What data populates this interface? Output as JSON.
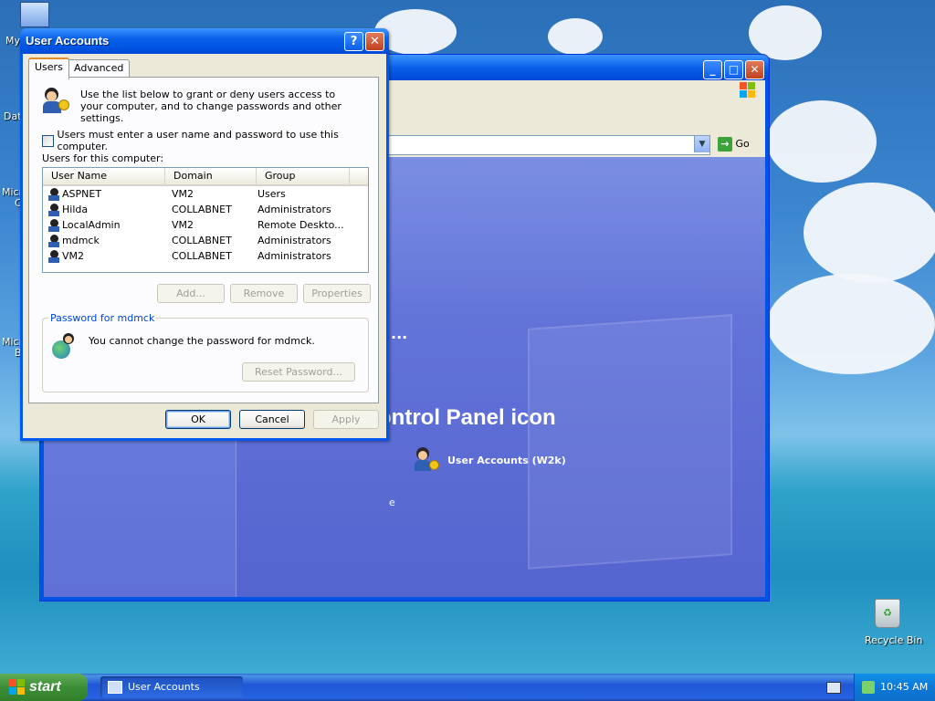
{
  "desktop": {
    "icons": [
      {
        "label": "My",
        "name": "my-computer"
      },
      {
        "label": "Dat",
        "name": "data"
      },
      {
        "label": "Micro",
        "name": "micro-1"
      },
      {
        "label": "Micro",
        "name": "micro-2"
      },
      {
        "label": "Recycle Bin",
        "name": "recycle-bin"
      }
    ],
    "icon_c": "C",
    "icon_b": "B"
  },
  "control_panel": {
    "go_label": "Go",
    "heading_fragment": "ontrol Panel icon",
    "ellipsis": "...",
    "item_label": "User Accounts (W2k)",
    "left_fragment": "e"
  },
  "dialog": {
    "title": "User Accounts",
    "tabs": [
      {
        "label": "Users",
        "active": true
      },
      {
        "label": "Advanced",
        "active": false
      }
    ],
    "intro_text": "Use the list below to grant or deny users access to your computer, and to change passwords and other settings.",
    "checkbox_label": "Users must enter a user name and password to use this computer.",
    "checkbox_checked": false,
    "list_label": "Users for this computer:",
    "columns": [
      "User Name",
      "Domain",
      "Group"
    ],
    "rows": [
      {
        "user": "ASPNET",
        "domain": "VM2",
        "group": "Users"
      },
      {
        "user": "Hilda",
        "domain": "COLLABNET",
        "group": "Administrators"
      },
      {
        "user": "LocalAdmin",
        "domain": "VM2",
        "group": "Remote Deskto..."
      },
      {
        "user": "mdmck",
        "domain": "COLLABNET",
        "group": "Administrators"
      },
      {
        "user": "VM2",
        "domain": "COLLABNET",
        "group": "Administrators"
      }
    ],
    "buttons": {
      "add": "Add...",
      "remove": "Remove",
      "properties": "Properties"
    },
    "password_group_title": "Password for mdmck",
    "password_text": "You cannot change the password for mdmck.",
    "reset_password": "Reset Password...",
    "ok": "OK",
    "cancel": "Cancel",
    "apply": "Apply"
  },
  "taskbar": {
    "start_label": "start",
    "task_label": "User Accounts",
    "clock": "10:45 AM"
  },
  "colors": {
    "xp_blue": "#0058ee",
    "start_green": "#3c8e36",
    "tab_accent": "#e68b2c",
    "cp_content": "#6172d8"
  }
}
